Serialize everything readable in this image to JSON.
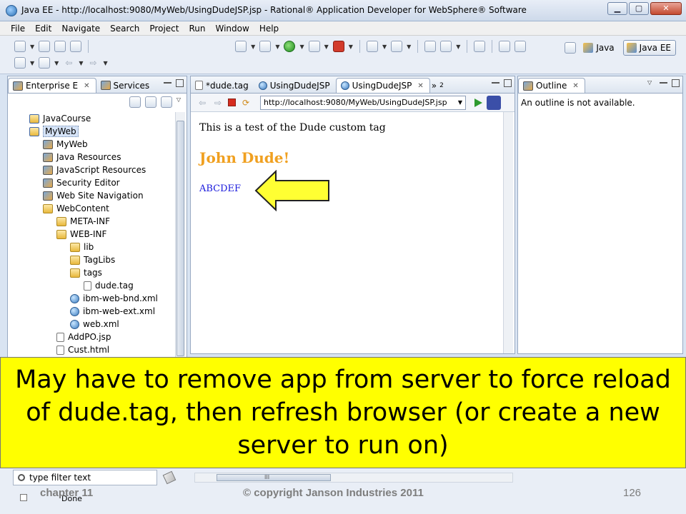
{
  "window": {
    "title": "Java EE - http://localhost:9080/MyWeb/UsingDudeJSP.jsp - Rational® Application Developer for WebSphere® Software",
    "minimize": "▁",
    "maximize": "▢",
    "close": "✕"
  },
  "menubar": [
    "File",
    "Edit",
    "Navigate",
    "Search",
    "Project",
    "Run",
    "Window",
    "Help"
  ],
  "perspectives": {
    "java": "Java",
    "javaee": "Java EE"
  },
  "explorer": {
    "tabs": [
      {
        "label": "Enterprise E",
        "close": "✕"
      },
      {
        "label": "Services"
      }
    ],
    "tree": [
      {
        "label": "JavaCourse",
        "icon": "project-icon",
        "depth": 1
      },
      {
        "label": "MyWeb",
        "icon": "project-icon",
        "depth": 1,
        "selected": true
      },
      {
        "label": "MyWeb",
        "icon": "config-icon",
        "depth": 2
      },
      {
        "label": "Java Resources",
        "icon": "config-icon",
        "depth": 2
      },
      {
        "label": "JavaScript Resources",
        "icon": "config-icon",
        "depth": 2
      },
      {
        "label": "Security Editor",
        "icon": "config-icon",
        "depth": 2
      },
      {
        "label": "Web Site Navigation",
        "icon": "config-icon",
        "depth": 2
      },
      {
        "label": "WebContent",
        "icon": "folder-icon",
        "depth": 2
      },
      {
        "label": "META-INF",
        "icon": "folder-icon",
        "depth": 3
      },
      {
        "label": "WEB-INF",
        "icon": "folder-icon",
        "depth": 3
      },
      {
        "label": "lib",
        "icon": "folder-icon",
        "depth": 4
      },
      {
        "label": "TagLibs",
        "icon": "folder-icon",
        "depth": 4
      },
      {
        "label": "tags",
        "icon": "folder-icon",
        "depth": 4
      },
      {
        "label": "dude.tag",
        "icon": "file-icon",
        "depth": 5
      },
      {
        "label": "ibm-web-bnd.xml",
        "icon": "globe-icon",
        "depth": 4
      },
      {
        "label": "ibm-web-ext.xml",
        "icon": "globe-icon",
        "depth": 4
      },
      {
        "label": "web.xml",
        "icon": "globe-icon",
        "depth": 4
      },
      {
        "label": "AddPO.jsp",
        "icon": "file-icon",
        "depth": 3
      },
      {
        "label": "Cust.html",
        "icon": "file-icon",
        "depth": 3
      }
    ]
  },
  "editor": {
    "tabs": [
      {
        "label": "*dude.tag",
        "close": ""
      },
      {
        "label": "UsingDudeJSP",
        "close": ""
      },
      {
        "label": "UsingDudeJSP",
        "close": "✕"
      }
    ],
    "overflow": "»",
    "overflow_count": "2"
  },
  "browser": {
    "url": "http://localhost:9080/MyWeb/UsingDudeJSP.jsp",
    "line1": "This is a test of the Dude custom tag",
    "heading": "John Dude!",
    "output": "ABCDEF"
  },
  "outline": {
    "tab": "Outline",
    "close": "✕",
    "message": "An outline is not available."
  },
  "bottom": {
    "filter_placeholder": "type filter text",
    "status": "Done",
    "scroll_mark": "III"
  },
  "callout": {
    "text": "May have to remove app from server to force reload of dude.tag, then refresh browser (or create a new server to run on)"
  },
  "footer": {
    "chapter": "chapter 11",
    "copyright": "© copyright Janson Industries 2011",
    "page": "126"
  },
  "colors": {
    "callout_bg": "#ffff00",
    "heading": "#f0a020",
    "link_text": "#1a1adc",
    "arrow_fill": "#ffff33"
  }
}
